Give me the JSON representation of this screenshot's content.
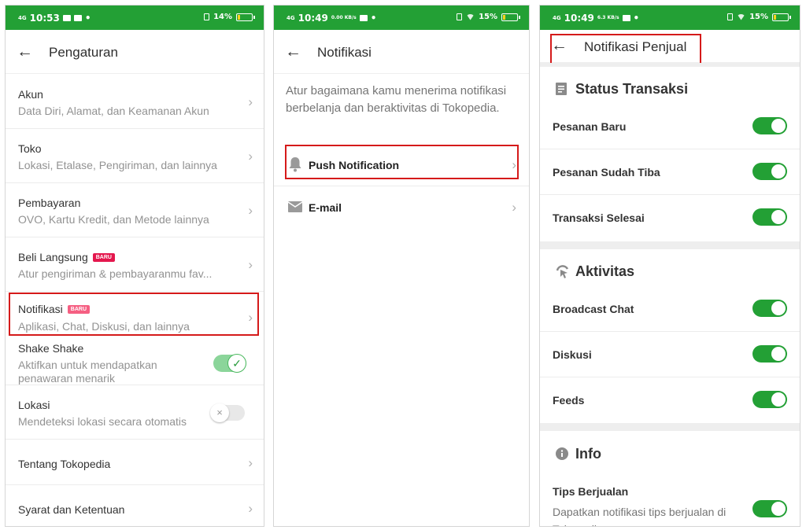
{
  "screen1": {
    "status": {
      "network": "4G",
      "time": "10:53",
      "battery": "14%"
    },
    "title": "Pengaturan",
    "back_glyph": "←",
    "items": [
      {
        "label": "Akun",
        "sub": "Data Diri, Alamat, dan Keamanan Akun"
      },
      {
        "label": "Toko",
        "sub": "Lokasi, Etalase, Pengiriman, dan lainnya"
      },
      {
        "label": "Pembayaran",
        "sub": "OVO, Kartu Kredit, dan Metode lainnya"
      },
      {
        "label": "Beli Langsung",
        "badge": "BARU",
        "sub": "Atur pengiriman & pembayaranmu fav..."
      },
      {
        "label": "Notifikasi",
        "badge": "BARU",
        "sub": "Aplikasi, Chat, Diskusi, dan lainnya"
      }
    ],
    "shake": {
      "label": "Shake Shake",
      "sub": "Aktifkan untuk mendapatkan penawaran menarik",
      "enabled": true
    },
    "lokasi": {
      "label": "Lokasi",
      "sub": "Mendeteksi lokasi secara otomatis",
      "enabled": false
    },
    "tentang": "Tentang Tokopedia",
    "syarat": "Syarat dan Ketentuan"
  },
  "screen2": {
    "status": {
      "network": "4G",
      "time": "10:49",
      "speed": "0.00 KB/s",
      "battery": "15%"
    },
    "title": "Notifikasi",
    "back_glyph": "←",
    "description": "Atur bagaimana kamu menerima notifikasi berbelanja dan beraktivitas di Tokopedia.",
    "rows": [
      {
        "label": "Push Notification",
        "icon": "bell-icon"
      },
      {
        "label": "E-mail",
        "icon": "mail-icon"
      }
    ]
  },
  "screen3": {
    "status": {
      "network": "4G",
      "time": "10:49",
      "speed": "6.3 KB/s",
      "battery": "15%"
    },
    "title": "Notifikasi Penjual",
    "back_glyph": "←",
    "sections": [
      {
        "title": "Status Transaksi",
        "icon": "receipt-icon",
        "items": [
          {
            "label": "Pesanan Baru",
            "enabled": true
          },
          {
            "label": "Pesanan Sudah Tiba",
            "enabled": true
          },
          {
            "label": "Transaksi Selesai",
            "enabled": true
          }
        ]
      },
      {
        "title": "Aktivitas",
        "icon": "activity-icon",
        "items": [
          {
            "label": "Broadcast Chat",
            "enabled": true
          },
          {
            "label": "Diskusi",
            "enabled": true
          },
          {
            "label": "Feeds",
            "enabled": true
          }
        ]
      },
      {
        "title": "Info",
        "icon": "info-icon",
        "items": [
          {
            "label": "Tips Berjualan",
            "sub": "Dapatkan notifikasi tips berjualan di Tokopedia",
            "enabled": true
          }
        ]
      }
    ]
  },
  "colors": {
    "brand_green": "#23a035",
    "highlight_red": "#d51a1a",
    "badge_red": "#e4174d"
  }
}
